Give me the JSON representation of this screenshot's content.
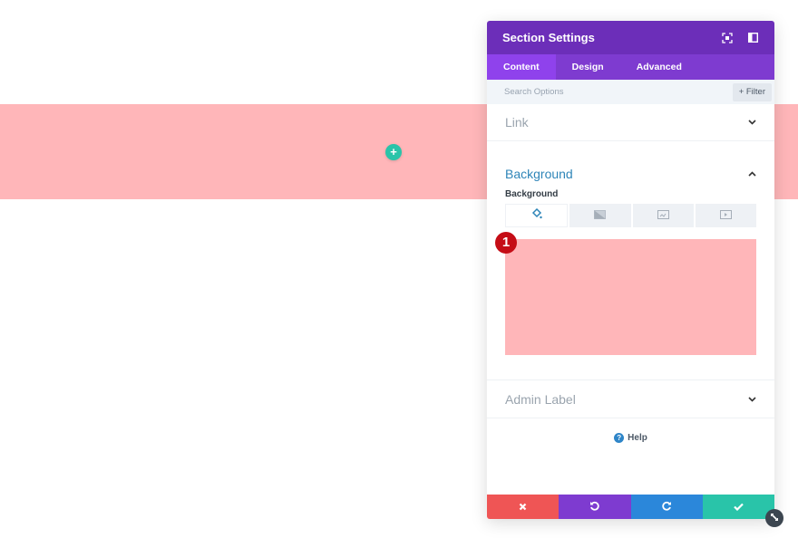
{
  "canvas": {
    "section_color": "#ffb6b9",
    "add_row_label": "+"
  },
  "panel": {
    "title": "Section Settings",
    "header_icons": [
      "expand-icon",
      "split-view-icon"
    ],
    "tabs": [
      {
        "label": "Content",
        "active": true
      },
      {
        "label": "Design",
        "active": false
      },
      {
        "label": "Advanced",
        "active": false
      }
    ],
    "search": {
      "placeholder": "Search Options",
      "value": ""
    },
    "filter_label": "+ Filter",
    "groups": {
      "link": {
        "title": "Link",
        "expanded": false
      },
      "background": {
        "title": "Background",
        "expanded": true,
        "field_label": "Background",
        "bg_tabs": [
          "color-fill-icon",
          "gradient-icon",
          "image-icon",
          "video-icon"
        ],
        "active_tab": 0,
        "color_value": "#ffb6b9",
        "badge": "1"
      },
      "admin_label": {
        "title": "Admin Label",
        "expanded": false
      }
    },
    "help_label": "Help",
    "footer": {
      "cancel_color": "#ef5555",
      "undo_color": "#7e3bd0",
      "redo_color": "#2b87da",
      "save_color": "#29c4a9"
    }
  }
}
